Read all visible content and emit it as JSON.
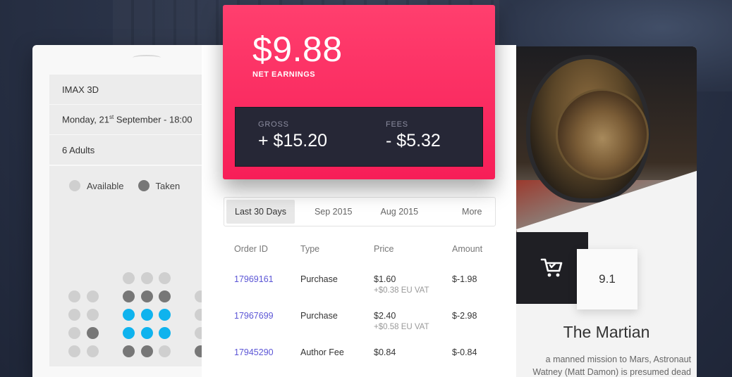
{
  "booking": {
    "format": "IMAX 3D",
    "date_prefix": "Monday, 21",
    "date_suffix": "st",
    "date_rest": " September - 18:00",
    "guests": "6 Adults",
    "legend": {
      "available": "Available",
      "taken": "Taken"
    }
  },
  "earnings": {
    "net_amount": "$9.88",
    "net_label": "NET EARNINGS",
    "gross_label": "GROSS",
    "gross_value": "+ $15.20",
    "fees_label": "FEES",
    "fees_value": "- $5.32"
  },
  "orders": {
    "tabs": [
      "Last 30 Days",
      "Sep 2015",
      "Aug 2015",
      "More"
    ],
    "active_tab": "Last 30 Days",
    "columns": [
      "Order ID",
      "Type",
      "Price",
      "Amount"
    ],
    "rows": [
      {
        "id": "17969161",
        "type": "Purchase",
        "price": "$1.60",
        "vat": "+$0.38 EU VAT",
        "amount": "$-1.98"
      },
      {
        "id": "17967699",
        "type": "Purchase",
        "price": "$2.40",
        "vat": "+$0.58 EU VAT",
        "amount": "$-2.98"
      },
      {
        "id": "17945290",
        "type": "Author Fee",
        "price": "$0.84",
        "vat": "",
        "amount": "$-0.84"
      }
    ]
  },
  "movie": {
    "title": "The Martian",
    "rating": "9.1",
    "description_line1": "a manned mission to Mars, Astronaut",
    "description_line2": "Watney (Matt Damon) is presumed dead",
    "cart_icon": "shopping-cart-icon"
  },
  "colors": {
    "accent_pink": "#f71e58",
    "dark_panel": "#262736",
    "seat_selected": "#0fb3ee",
    "seat_taken": "#777777",
    "seat_available": "#cfcfcf",
    "link": "#5c56d6"
  }
}
